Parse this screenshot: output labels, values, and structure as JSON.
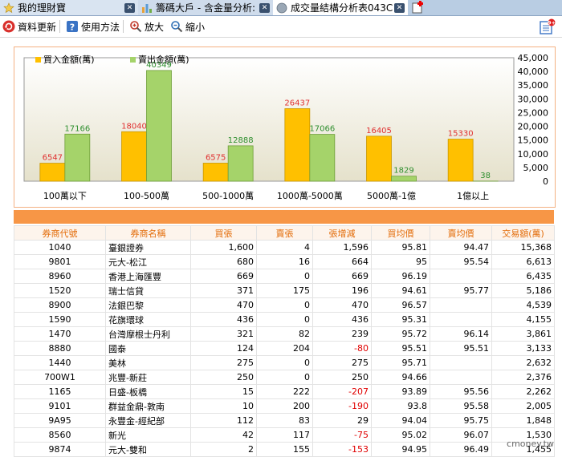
{
  "tabs": [
    {
      "label": "我的理財寶",
      "icon": "star-icon"
    },
    {
      "label": "籌碼大戶 - 含金量分析:",
      "icon": "bar-chart-icon"
    },
    {
      "label": "成交量結構分析表043C",
      "icon": "globe-icon"
    }
  ],
  "toolbar": {
    "refresh": "資料更新",
    "help": "使用方法",
    "zoom_in": "放大",
    "zoom_out": "縮小"
  },
  "legend": {
    "buy": "買入金額(萬)",
    "sell": "賣出金額(萬)"
  },
  "colors": {
    "buy": "#ffc000",
    "sell": "#a5d36a",
    "accent": "#f79646",
    "negative": "#e00000"
  },
  "chart_data": {
    "type": "bar",
    "categories": [
      "100萬以下",
      "100-500萬",
      "500-1000萬",
      "1000萬-5000萬",
      "5000萬-1億",
      "1億以上"
    ],
    "series": [
      {
        "name": "買入金額(萬)",
        "values": [
          6547,
          18040,
          6575,
          26437,
          16405,
          15330
        ]
      },
      {
        "name": "賣出金額(萬)",
        "values": [
          17166,
          40349,
          12888,
          17066,
          1829,
          38
        ]
      }
    ],
    "ylim": [
      0,
      45000
    ],
    "yticks": [
      "45,000",
      "40,000",
      "35,000",
      "30,000",
      "25,000",
      "20,000",
      "15,000",
      "10,000",
      "5,000",
      "0"
    ],
    "legend_position": "top-left",
    "grid": false
  },
  "table": {
    "headers": [
      "券商代號",
      "券商名稱",
      "買張",
      "賣張",
      "張增減",
      "買均價",
      "賣均價",
      "交易額(萬)"
    ],
    "rows": [
      [
        "1040",
        "臺銀證券",
        "1,600",
        "4",
        "1,596",
        "95.81",
        "94.47",
        "15,368"
      ],
      [
        "9801",
        "元大-松江",
        "680",
        "16",
        "664",
        "95",
        "95.54",
        "6,613"
      ],
      [
        "8960",
        "香港上海匯豐",
        "669",
        "0",
        "669",
        "96.19",
        "",
        "6,435"
      ],
      [
        "1520",
        "瑞士信貸",
        "371",
        "175",
        "196",
        "94.61",
        "95.77",
        "5,186"
      ],
      [
        "8900",
        "法銀巴黎",
        "470",
        "0",
        "470",
        "96.57",
        "",
        "4,539"
      ],
      [
        "1590",
        "花旗環球",
        "436",
        "0",
        "436",
        "95.31",
        "",
        "4,155"
      ],
      [
        "1470",
        "台灣摩根士丹利",
        "321",
        "82",
        "239",
        "95.72",
        "96.14",
        "3,861"
      ],
      [
        "8880",
        "國泰",
        "124",
        "204",
        "-80",
        "95.51",
        "95.51",
        "3,133"
      ],
      [
        "1440",
        "美林",
        "275",
        "0",
        "275",
        "95.71",
        "",
        "2,632"
      ],
      [
        "700W1",
        "兆豐-新莊",
        "250",
        "0",
        "250",
        "94.66",
        "",
        "2,376"
      ],
      [
        "1165",
        "日盛-板橋",
        "15",
        "222",
        "-207",
        "93.89",
        "95.56",
        "2,262"
      ],
      [
        "9101",
        "群益金鼎-敦南",
        "10",
        "200",
        "-190",
        "93.8",
        "95.58",
        "2,005"
      ],
      [
        "9A95",
        "永豐金-經紀部",
        "112",
        "83",
        "29",
        "94.04",
        "95.75",
        "1,848"
      ],
      [
        "8560",
        "新光",
        "42",
        "117",
        "-75",
        "95.02",
        "96.07",
        "1,530"
      ],
      [
        "9874",
        "元大-雙和",
        "2",
        "155",
        "-153",
        "94.95",
        "96.49",
        "1,455"
      ]
    ]
  },
  "watermark": "cmoney.tw"
}
